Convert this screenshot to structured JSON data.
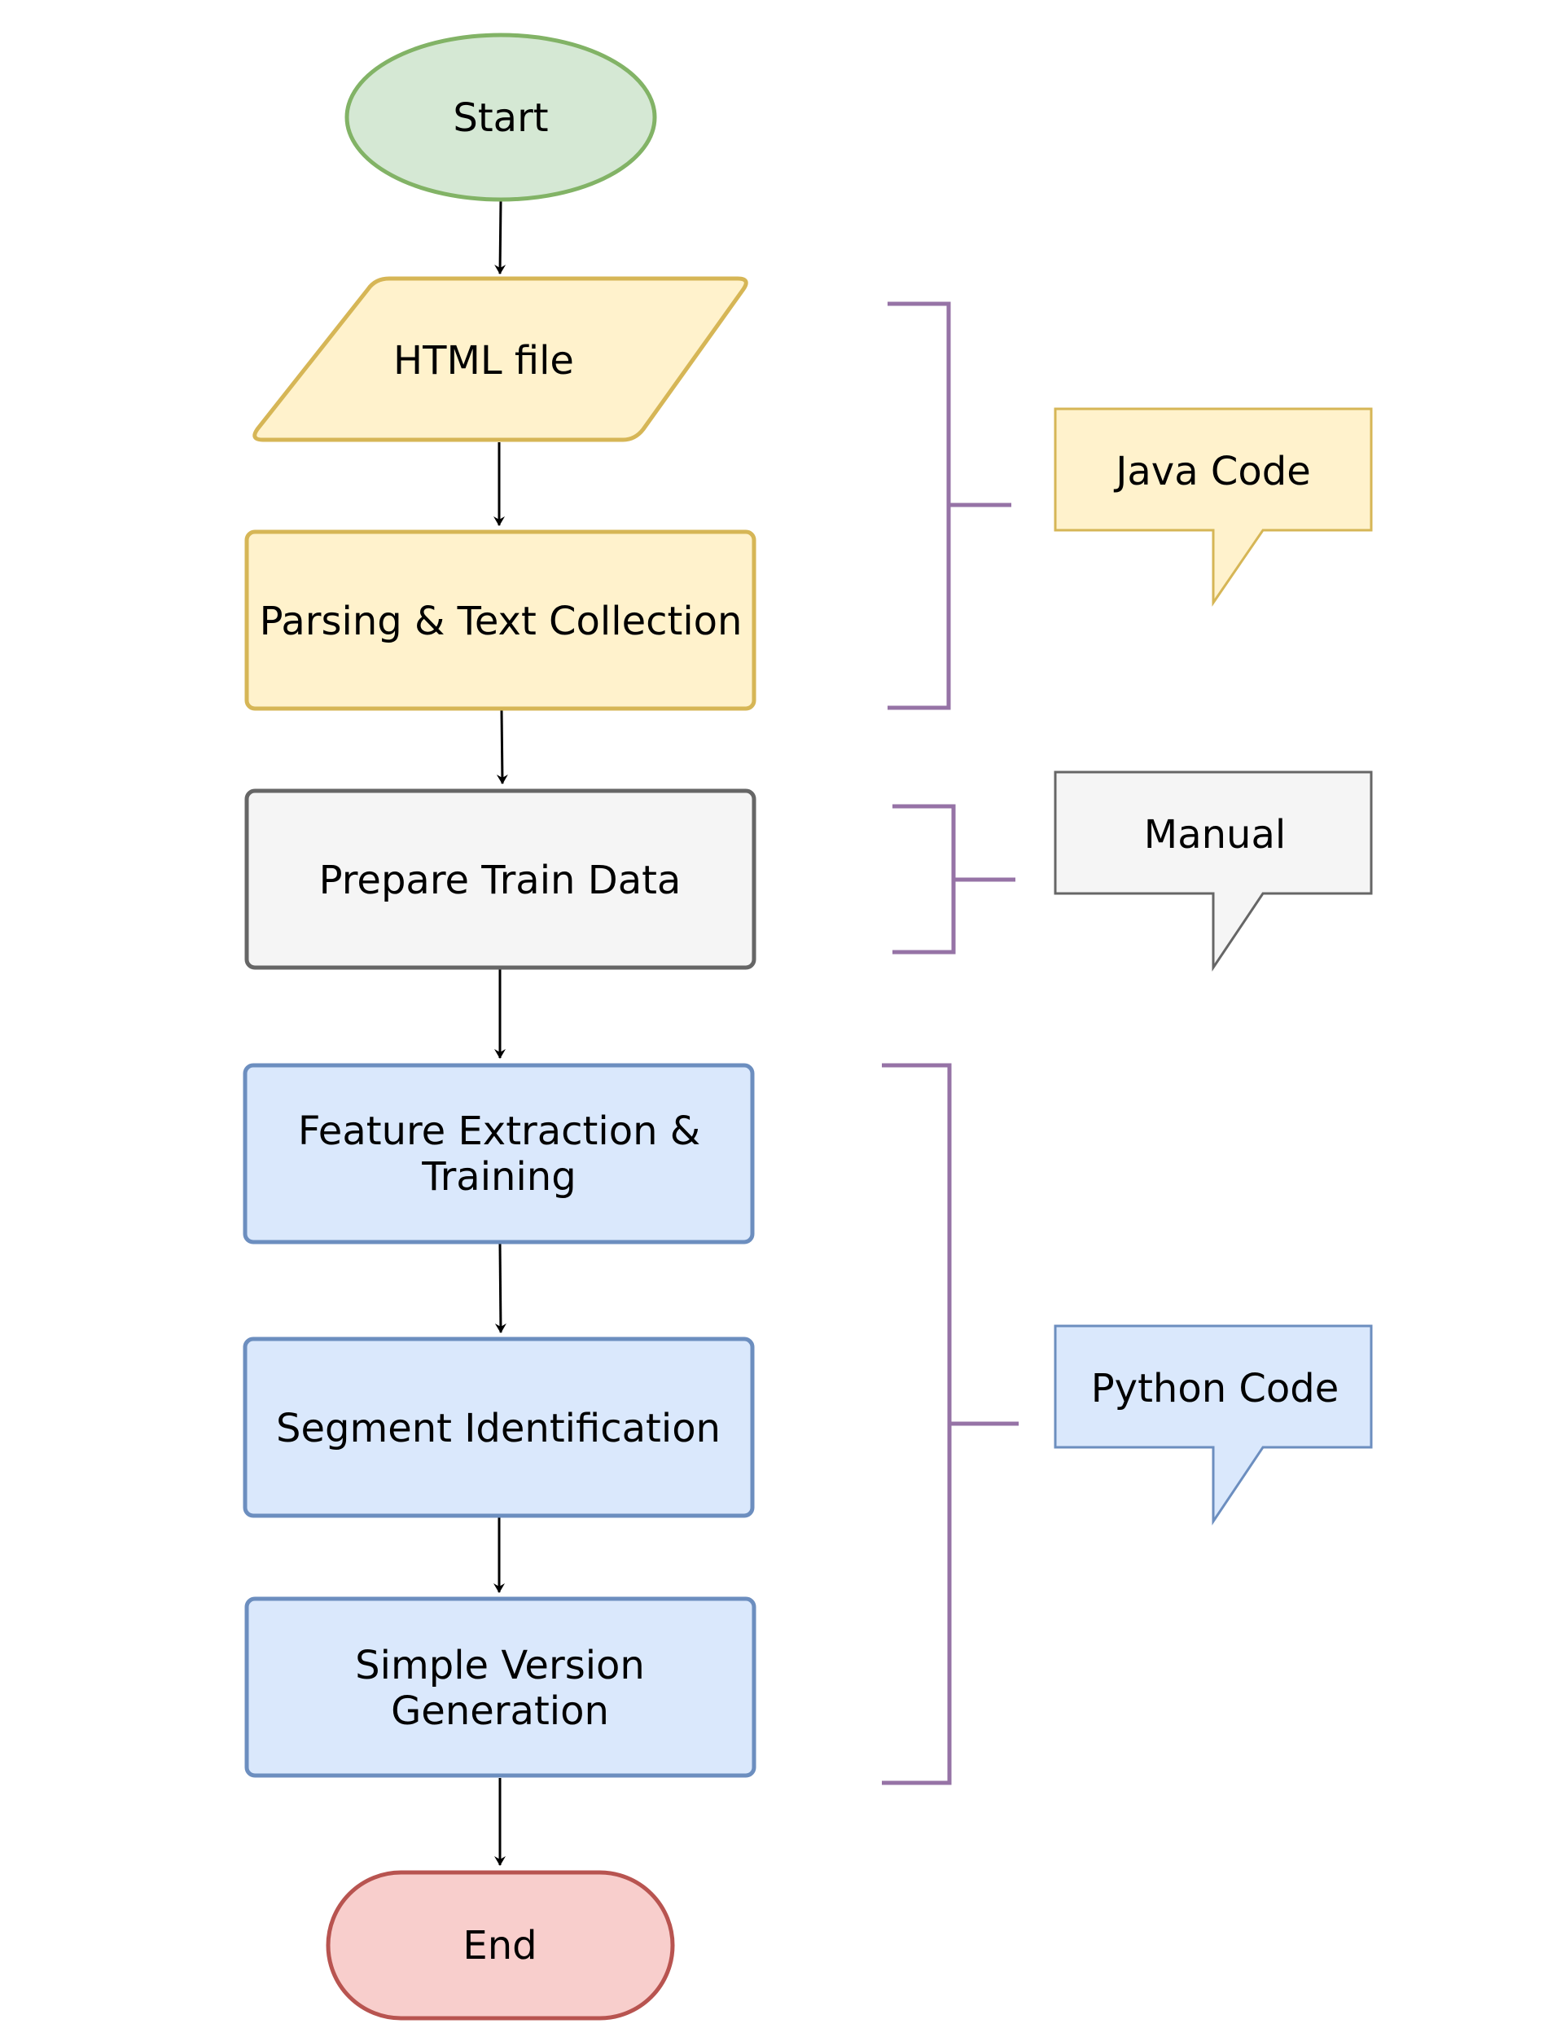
{
  "diagram": {
    "type": "flowchart",
    "nodes": [
      {
        "id": "start",
        "shape": "terminator-ellipse",
        "lines": [
          "Start"
        ],
        "fill": "#d5e8d4",
        "stroke": "#82b366"
      },
      {
        "id": "html-file",
        "shape": "parallelogram",
        "lines": [
          "HTML file"
        ],
        "fill": "#fff2cc",
        "stroke": "#d6b656"
      },
      {
        "id": "parsing",
        "shape": "process",
        "lines": [
          "Parsing & Text Collection"
        ],
        "fill": "#fff2cc",
        "stroke": "#d6b656"
      },
      {
        "id": "prepare",
        "shape": "process",
        "lines": [
          "Prepare Train Data"
        ],
        "fill": "#f5f5f5",
        "stroke": "#666666"
      },
      {
        "id": "feature",
        "shape": "process",
        "lines": [
          "Feature Extraction &",
          "Training"
        ],
        "fill": "#dae8fc",
        "stroke": "#6c8ebf"
      },
      {
        "id": "segment",
        "shape": "process",
        "lines": [
          "Segment Identification"
        ],
        "fill": "#dae8fc",
        "stroke": "#6c8ebf"
      },
      {
        "id": "simple",
        "shape": "process",
        "lines": [
          "Simple Version",
          "Generation"
        ],
        "fill": "#dae8fc",
        "stroke": "#6c8ebf"
      },
      {
        "id": "end",
        "shape": "terminator-pill",
        "lines": [
          "End"
        ],
        "fill": "#f8cecc",
        "stroke": "#b85450"
      }
    ],
    "edges": [
      [
        "start",
        "html-file"
      ],
      [
        "html-file",
        "parsing"
      ],
      [
        "parsing",
        "prepare"
      ],
      [
        "prepare",
        "feature"
      ],
      [
        "feature",
        "segment"
      ],
      [
        "segment",
        "simple"
      ],
      [
        "simple",
        "end"
      ]
    ],
    "groups": [
      {
        "id": "java",
        "label": "Java Code",
        "covers": [
          "html-file",
          "parsing"
        ],
        "fill": "#fff2cc",
        "stroke": "#d6b656"
      },
      {
        "id": "manual",
        "label": "Manual",
        "covers": [
          "prepare"
        ],
        "fill": "#f5f5f5",
        "stroke": "#666666"
      },
      {
        "id": "python",
        "label": "Python Code",
        "covers": [
          "feature",
          "segment",
          "simple"
        ],
        "fill": "#dae8fc",
        "stroke": "#6c8ebf"
      }
    ],
    "bracket_color": "#9673a6",
    "arrow_color": "#000000"
  }
}
